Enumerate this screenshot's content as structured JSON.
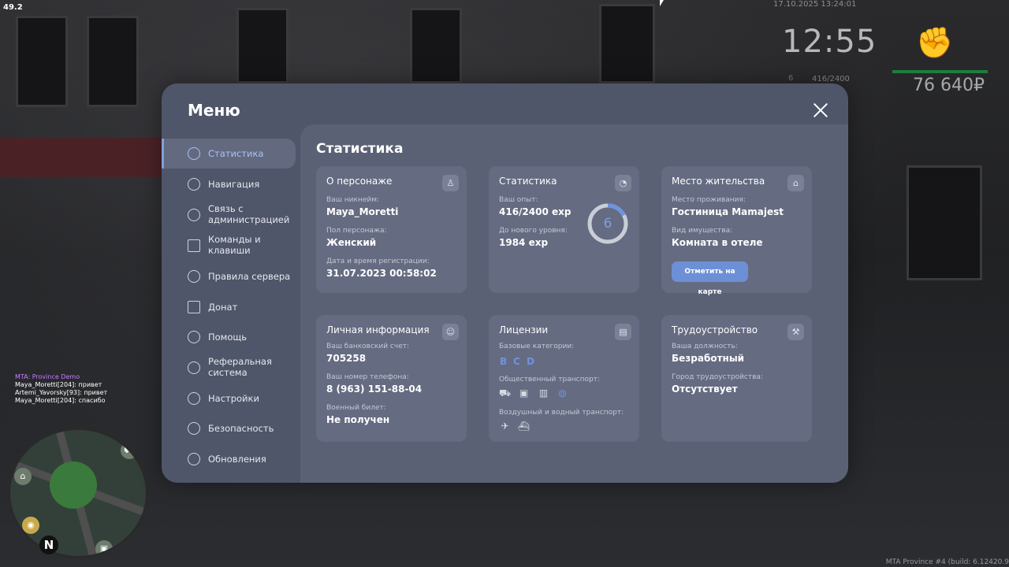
{
  "hud": {
    "fps": "49.2",
    "datetime": "17.10.2025 13:24:01",
    "clock": "12:55",
    "level": "6",
    "exp": "416/2400",
    "money": "76 640₽",
    "build": "MTA Province #4 (build: 6.12420.9"
  },
  "chat": {
    "title": "MTA: Province Demo",
    "lines": [
      "Maya_Moretti[204]: привет",
      "Artemi_Yavorsky[93]: привет",
      "Maya_Moretti[204]: спасибо"
    ]
  },
  "minimap": {
    "compass": "N"
  },
  "menu": {
    "title": "Меню",
    "nav": [
      {
        "label": "Статистика",
        "icon": "chart-pie-icon"
      },
      {
        "label": "Навигация",
        "icon": "compass-icon"
      },
      {
        "label": "Связь с администрацией",
        "icon": "headset-icon"
      },
      {
        "label": "Команды и клавиши",
        "icon": "document-icon"
      },
      {
        "label": "Правила сервера",
        "icon": "scales-icon"
      },
      {
        "label": "Донат",
        "icon": "wallet-icon"
      },
      {
        "label": "Помощь",
        "icon": "heart-hand-icon"
      },
      {
        "label": "Реферальная система",
        "icon": "network-icon"
      },
      {
        "label": "Настройки",
        "icon": "gear-icon"
      },
      {
        "label": "Безопасность",
        "icon": "shield-icon"
      },
      {
        "label": "Обновления",
        "icon": "refresh-check-icon"
      }
    ],
    "active_index": 0
  },
  "content": {
    "title": "Статистика",
    "character": {
      "title": "О персонаже",
      "nickname_label": "Ваш никнейм:",
      "nickname": "Maya_Moretti",
      "gender_label": "Пол персонажа:",
      "gender": "Женский",
      "reg_label": "Дата и время регистрации:",
      "reg": "31.07.2023 00:58:02"
    },
    "stats": {
      "title": "Статистика",
      "exp_label": "Ваш опыт:",
      "exp": "416/2400 exp",
      "next_label": "До нового уровня:",
      "next": "1984 exp",
      "level": "6",
      "progress": 0.173
    },
    "residence": {
      "title": "Место жительства",
      "place_label": "Место проживания:",
      "place": "Гостиница Mamajest",
      "prop_label": "Вид имущества:",
      "prop": "Комната в отеле",
      "button": "Отметить на карте"
    },
    "personal": {
      "title": "Личная информация",
      "bank_label": "Ваш банковский счет:",
      "bank": "705258",
      "phone_label": "Ваш номер телефона:",
      "phone": "8 (963) 151-88-04",
      "military_label": "Военный билет:",
      "military": "Не получен"
    },
    "licenses": {
      "title": "Лицензии",
      "base_label": "Базовые категории:",
      "categories": [
        "B",
        "C",
        "D"
      ],
      "public_label": "Общественный транспорт:",
      "air_label": "Воздушный и водный транспорт:"
    },
    "employment": {
      "title": "Трудоустройство",
      "position_label": "Ваша должность:",
      "position": "Безработный",
      "city_label": "Город трудоустройства:",
      "city": "Отсутствует"
    }
  },
  "colors": {
    "panel": "#4f5669",
    "content": "#5b6175",
    "card": "#656b81",
    "accent": "#7d9fe0",
    "button": "#6d8fd6"
  }
}
